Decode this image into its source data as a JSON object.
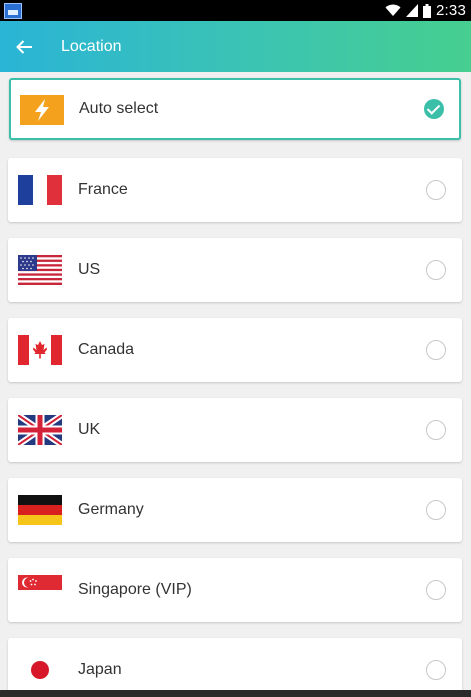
{
  "status_bar": {
    "time": "2:33",
    "icons": [
      "app-notification-icon",
      "wifi-icon",
      "signal-icon",
      "battery-icon"
    ]
  },
  "app_bar": {
    "title": "Location",
    "back_icon": "arrow-back-icon",
    "gradient": [
      "#2ab4d6",
      "#46cf8f"
    ]
  },
  "locations": [
    {
      "label": "Auto select",
      "flag": "lightning-icon",
      "selected": true
    },
    {
      "label": "France",
      "flag": "france-flag",
      "selected": false
    },
    {
      "label": "US",
      "flag": "us-flag",
      "selected": false
    },
    {
      "label": "Canada",
      "flag": "canada-flag",
      "selected": false
    },
    {
      "label": "UK",
      "flag": "uk-flag",
      "selected": false
    },
    {
      "label": "Germany",
      "flag": "germany-flag",
      "selected": false
    },
    {
      "label": "Singapore (VIP)",
      "flag": "singapore-flag",
      "selected": false
    },
    {
      "label": "Japan",
      "flag": "japan-flag",
      "selected": false
    }
  ],
  "colors": {
    "accent": "#3bbfa9",
    "background": "#f0f0f0"
  }
}
